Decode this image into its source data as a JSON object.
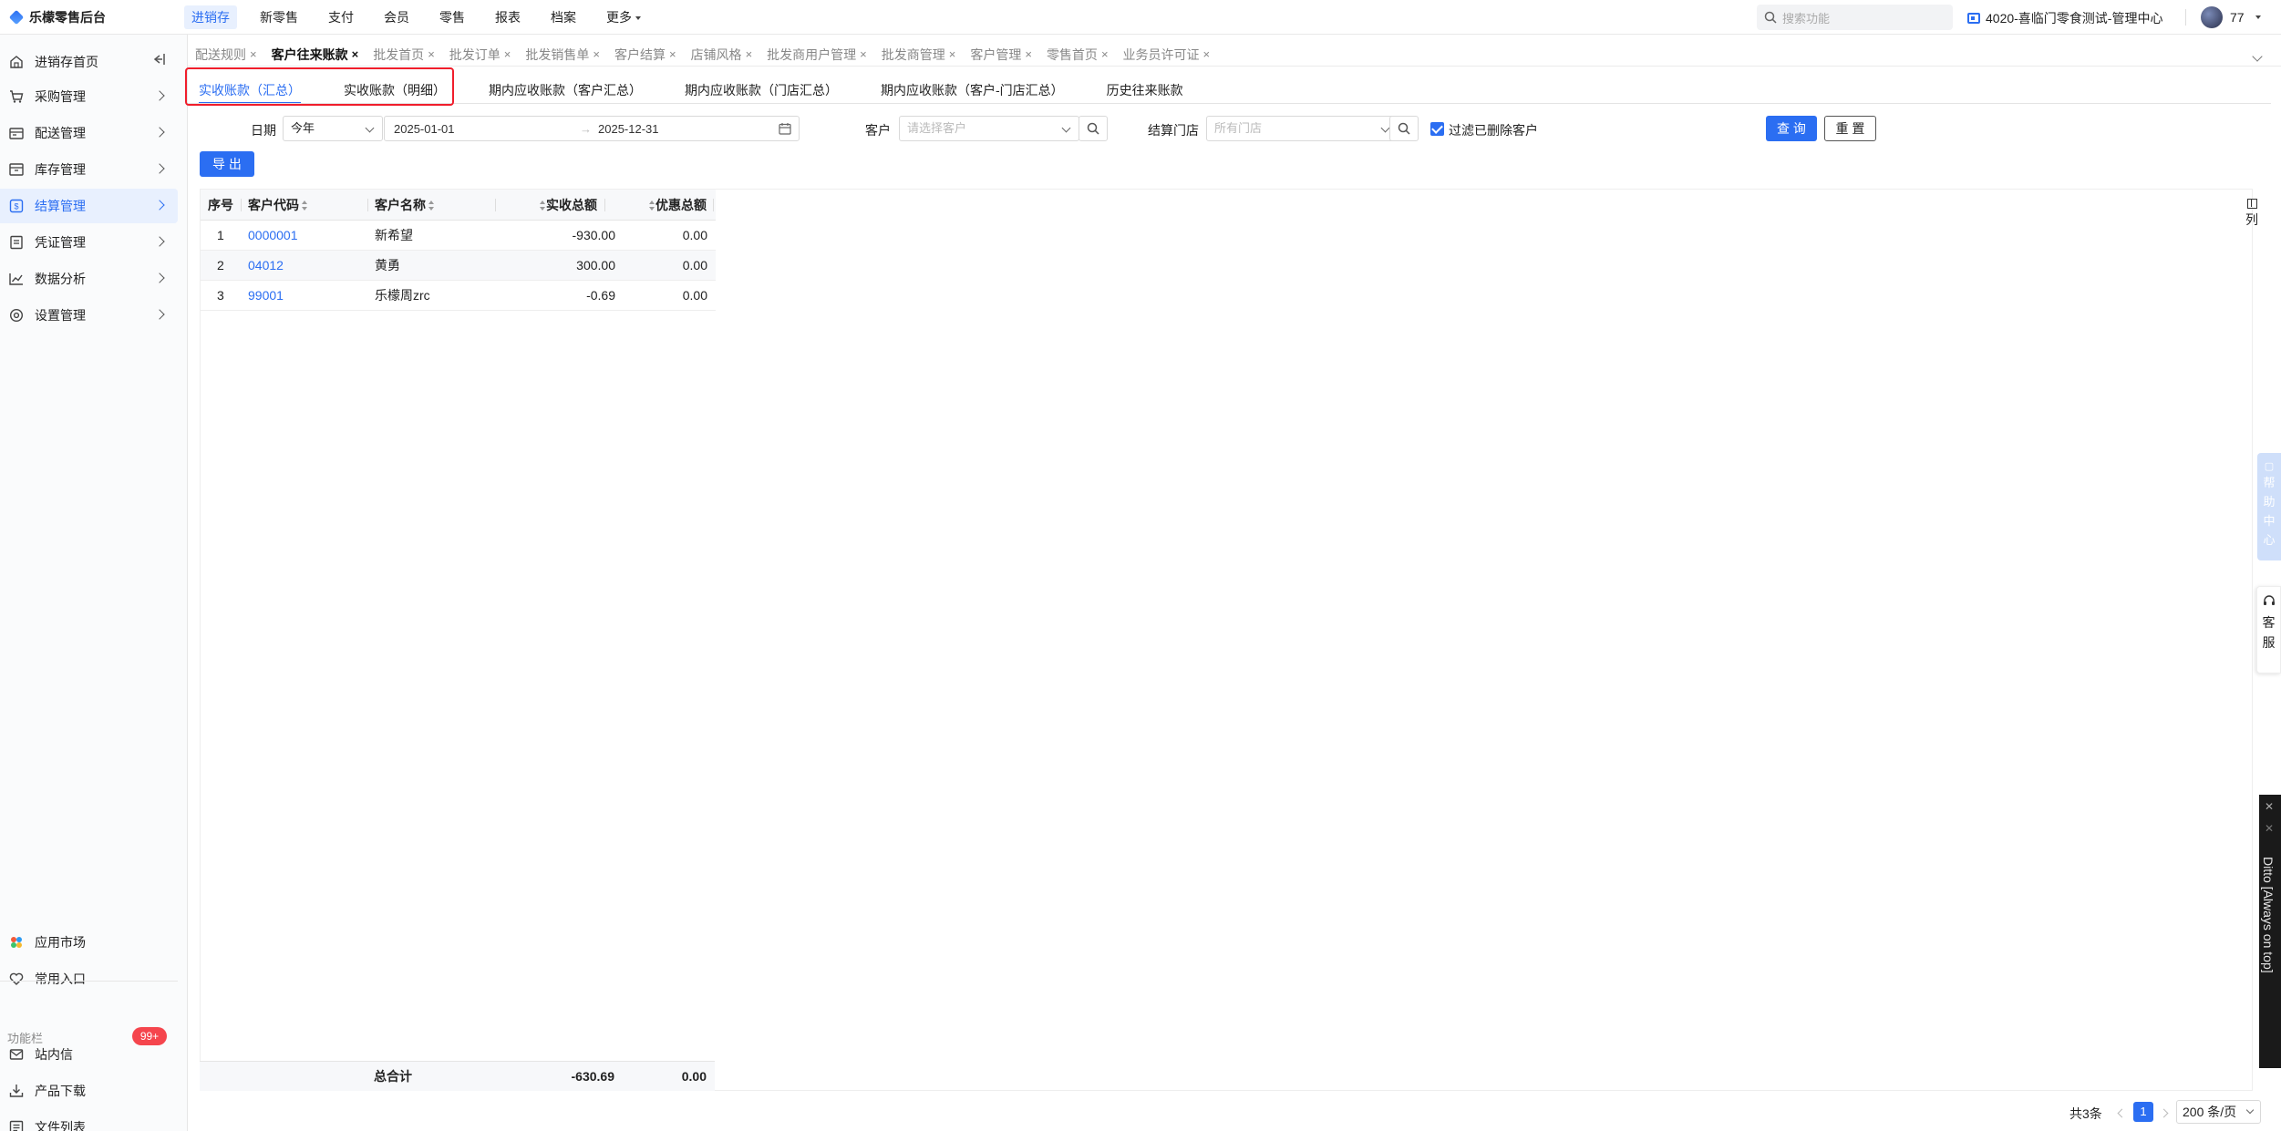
{
  "app": {
    "title": "乐檬零售后台"
  },
  "topnav": {
    "items": [
      "进销存",
      "新零售",
      "支付",
      "会员",
      "零售",
      "报表",
      "档案",
      "更多"
    ],
    "active_index": 0,
    "search_placeholder": "搜索功能",
    "store": "4020-喜临门零食测试-管理中心",
    "user": "77"
  },
  "sidebar": {
    "items": [
      {
        "label": "进销存首页",
        "icon": "home-icon"
      },
      {
        "label": "采购管理",
        "icon": "cart-icon"
      },
      {
        "label": "配送管理",
        "icon": "truck-icon"
      },
      {
        "label": "库存管理",
        "icon": "box-icon"
      },
      {
        "label": "结算管理",
        "icon": "settle-icon"
      },
      {
        "label": "凭证管理",
        "icon": "voucher-icon"
      },
      {
        "label": "数据分析",
        "icon": "chart-icon"
      },
      {
        "label": "设置管理",
        "icon": "gear-icon"
      }
    ],
    "active_index": 4,
    "bottom": {
      "app_market": "应用市场",
      "favorites": "常用入口",
      "caption": "功能栏",
      "messages": "站内信",
      "badge": "99+",
      "downloads": "产品下载",
      "files": "文件列表"
    }
  },
  "tabs": [
    "配送规则",
    "客户往来账款",
    "批发首页",
    "批发订单",
    "批发销售单",
    "客户结算",
    "店铺风格",
    "批发商用户管理",
    "批发商管理",
    "客户管理",
    "零售首页",
    "业务员许可证"
  ],
  "active_tab": 1,
  "subtabs": [
    "实收账款（汇总）",
    "实收账款（明细）",
    "期内应收账款（客户汇总）",
    "期内应收账款（门店汇总）",
    "期内应收账款（客户-门店汇总）",
    "历史往来账款"
  ],
  "active_subtab": 0,
  "filters": {
    "date_label": "日期",
    "date_preset": "今年",
    "date_start": "2025-01-01",
    "date_end": "2025-12-31",
    "date_arrow": "→",
    "customer_label": "客户",
    "customer_placeholder": "请选择客户",
    "store_label": "结算门店",
    "store_placeholder": "所有门店",
    "filter_deleted_label": "过滤已删除客户",
    "query_button": "查 询",
    "reset_button": "重 置",
    "export_button": "导 出"
  },
  "table": {
    "columns": [
      "序号",
      "客户代码",
      "客户名称",
      "实收总额",
      "优惠总额"
    ],
    "rows": [
      {
        "no": "1",
        "code": "0000001",
        "name": "新希望",
        "amount": "-930.00",
        "discount": "0.00"
      },
      {
        "no": "2",
        "code": "04012",
        "name": "黄勇",
        "amount": "300.00",
        "discount": "0.00"
      },
      {
        "no": "3",
        "code": "99001",
        "name": "乐檬周zrc",
        "amount": "-0.69",
        "discount": "0.00"
      }
    ],
    "total_label": "总合计",
    "total_amount": "-630.69",
    "total_discount": "0.00",
    "column_setting": "列"
  },
  "pager": {
    "total": "共3条",
    "page": "1",
    "page_size": "200 条/页"
  },
  "float": {
    "help": [
      "帮",
      "助",
      "中",
      "心"
    ],
    "service": [
      "客",
      "服"
    ],
    "ditto": "Ditto [Always on top]"
  },
  "colors": {
    "accent": "#2b6ef2",
    "highlight_box": "#f01e2c",
    "badge": "#f5454d"
  }
}
